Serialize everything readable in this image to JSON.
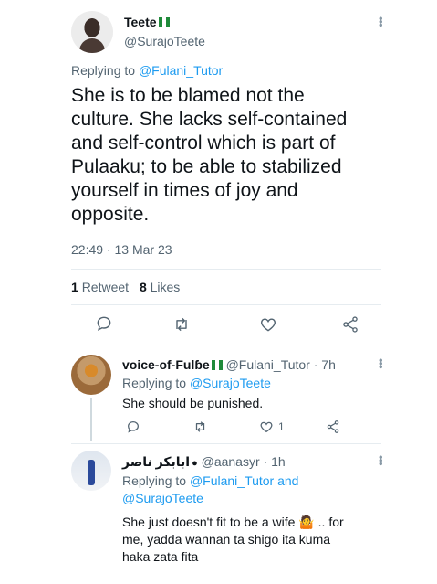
{
  "main_tweet": {
    "display_name": "Teete",
    "handle": "@SurajoTeete",
    "replying_prefix": "Replying to",
    "replying_to": "@Fulani_Tutor",
    "text": "She is to be blamed not the culture. She lacks self-contained and self-control which is part of Pulaaku; to be able to stabilized yourself in times of joy and opposite.",
    "time": "22:49",
    "separator": "·",
    "date": "13 Mar 23",
    "retweet_count": "1",
    "retweet_label": "Retweet",
    "like_count": "8",
    "like_label": "Likes",
    "actions": [
      "reply-icon",
      "retweet-icon",
      "like-icon",
      "share-icon"
    ]
  },
  "replies": [
    {
      "display_name": "voice-of-Fulɓe",
      "handle": "@Fulani_Tutor",
      "time_ago": "· 7h",
      "replying_prefix": "Replying to",
      "replying_to": "@SurajoTeete",
      "text": "She should be punished.",
      "like_count": "1"
    },
    {
      "display_name": "ابابكر ناصر",
      "handle": "@aanasyr",
      "time_ago": "· 1h",
      "replying_prefix": "Replying to",
      "replying_to": "@Fulani_Tutor and",
      "replying_to_2": "@SurajoTeete",
      "text_line1": "She just doesn't fit to be a wife",
      "emoji": "🤷",
      "text_line1_end": ".. for",
      "text_line2": "me, yadda wannan ta shigo ita kuma",
      "text_line3": "haka zata fita"
    }
  ],
  "colors": {
    "accent": "#1d9bf0",
    "muted": "#536471",
    "flag_green": "#1f8a3a"
  }
}
